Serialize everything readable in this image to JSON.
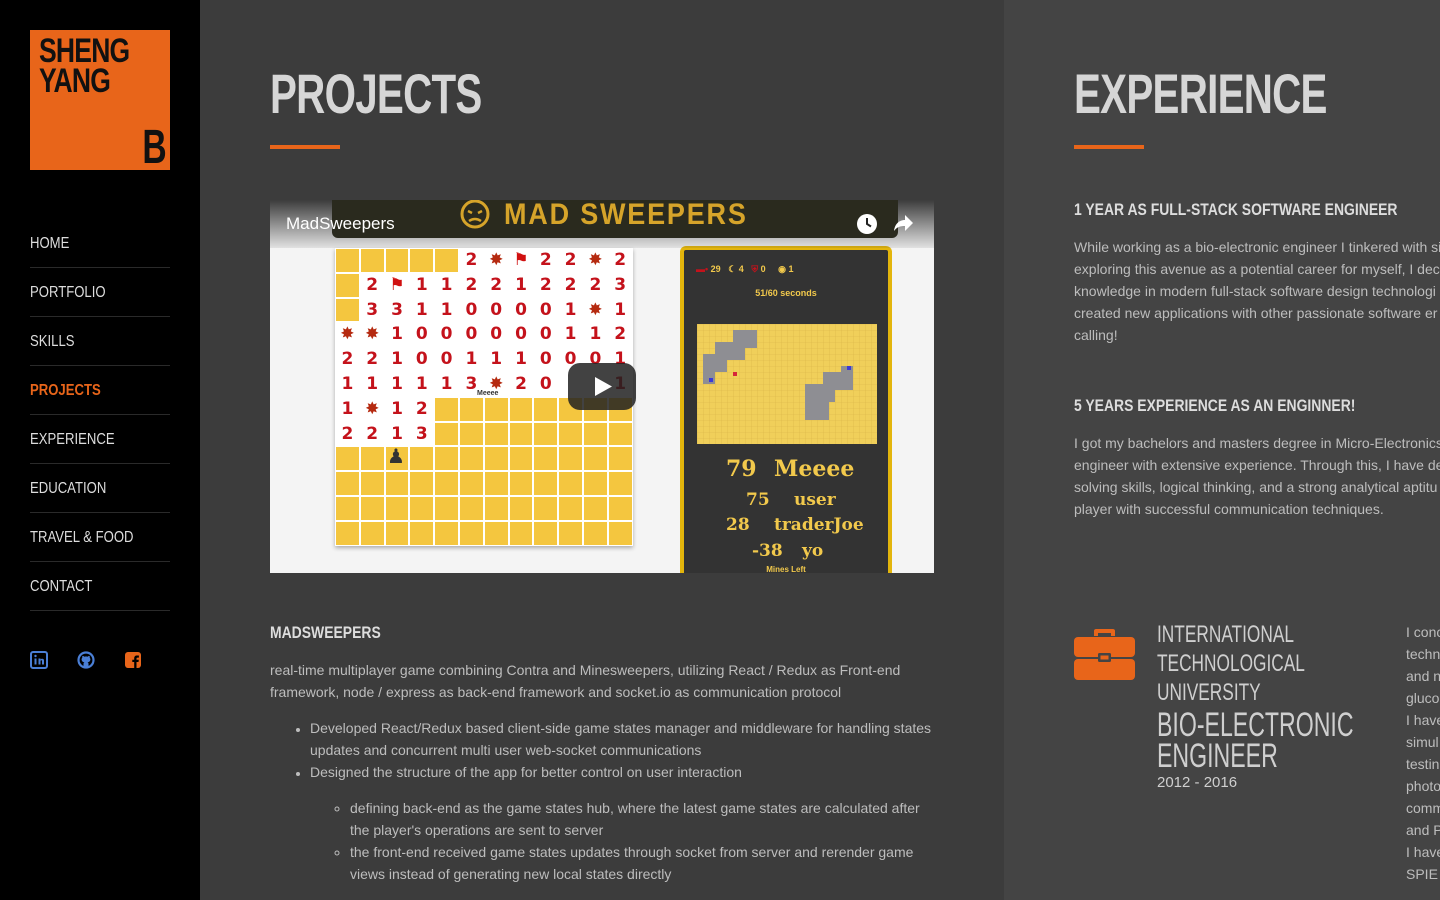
{
  "sidebar": {
    "logo": {
      "line1": "SHENG",
      "line2": "YANG",
      "mark": "B"
    },
    "nav": [
      {
        "label": "HOME",
        "active": false
      },
      {
        "label": "PORTFOLIO",
        "active": false
      },
      {
        "label": "SKILLS",
        "active": false
      },
      {
        "label": "PROJECTS",
        "active": true
      },
      {
        "label": "EXPERIENCE",
        "active": false
      },
      {
        "label": "EDUCATION",
        "active": false
      },
      {
        "label": "TRAVEL & FOOD",
        "active": false
      },
      {
        "label": "CONTACT",
        "active": false
      }
    ],
    "social": [
      {
        "icon": "linkedin-icon",
        "color": "#4a7fd6"
      },
      {
        "icon": "github-icon",
        "color": "#4a7fd6"
      },
      {
        "icon": "facebook-icon",
        "color": "#e8651a"
      }
    ]
  },
  "colors": {
    "accent": "#e8651a",
    "sidebar_bg": "#000000",
    "projects_bg": "#3c3c3c",
    "experience_bg": "#444444"
  },
  "projects": {
    "title": "PROJECTS",
    "video": {
      "title": "MadSweepers",
      "banner": "MAD SWEEPERS",
      "scoreboard": {
        "stats": [
          "29",
          "4",
          "0",
          "1"
        ],
        "timer": "51/60 seconds",
        "rows": [
          {
            "score": "79",
            "name": "Meeee"
          },
          {
            "score": "75",
            "name": "user"
          },
          {
            "score": "28",
            "name": "traderJoe"
          },
          {
            "score": "-38",
            "name": "yo"
          }
        ],
        "footer": "Mines Left"
      },
      "board_rows": [
        "x x x x x 2 * f 2 2 * 2",
        "x 2 f 1 1 2 2 1 2 2 2 3",
        "x 3 3 1 1 0 0 0 0 1 * 1",
        "* * 1 0 0 0 0 0 0 1 1 2",
        "2 2 1 0 0 1 1 1 0 0 0 1",
        "1 1 1 1 1 3 * 2 0 ? ? 1",
        "1 * 1 2 y y y y y y y y",
        "2 2 1 3 y y y y y y y y"
      ],
      "player_label": "Meeee"
    },
    "name": "MADSWEEPERS",
    "description_1": "real-time multiplayer game combining Contra and Minesweepers, utilizing React / Redux as Front-end",
    "description_2": "framework, node / express as back-end framework and socket.io as communication protocol",
    "bullets": [
      "Developed React/Redux based client-side game states manager and middleware for handling states",
      "updates and concurrent multi user web-socket communications",
      "Designed the structure of the app for better control on user interaction"
    ],
    "sub_bullets": [
      "defining back-end as the game states hub, where the latest game states are calculated after",
      "the player's operations are sent to server",
      "the front-end received game states updates through socket from server and rerender game",
      "views instead of generating new local states directly"
    ]
  },
  "experience": {
    "title": "EXPERIENCE",
    "item1": {
      "heading": "1 YEAR AS FULL-STACK SOFTWARE ENGINEER",
      "lines": [
        "While working as a bio-electronic engineer I tinkered with si",
        "exploring this avenue as a potential career for myself, I deci",
        "knowledge in modern full-stack software design technologi",
        "created new applications with other passionate software er",
        "calling!"
      ]
    },
    "item2": {
      "heading": "5 YEARS EXPERIENCE AS AN ENGINNER!",
      "lines": [
        "I got my bachelors and masters degree in Micro-Electronics",
        "engineer with extensive experience. Through this, I have de",
        "solving skills, logical thinking, and a strong analytical aptitu",
        "player with successful communication techniques."
      ]
    },
    "job": {
      "icon": "briefcase-icon",
      "org": "INTERNATIONAL\nTECHNOLOGICAL\nUNIVERSITY",
      "role": "BIO-ELECTRONIC\nENGINEER",
      "dates": "2012 - 2016",
      "details": [
        "I conc",
        "techn",
        "and n",
        "gluco",
        "I have",
        "simul",
        "testin",
        "photo",
        "comm",
        "and P",
        "I have",
        "SPIE"
      ]
    }
  }
}
